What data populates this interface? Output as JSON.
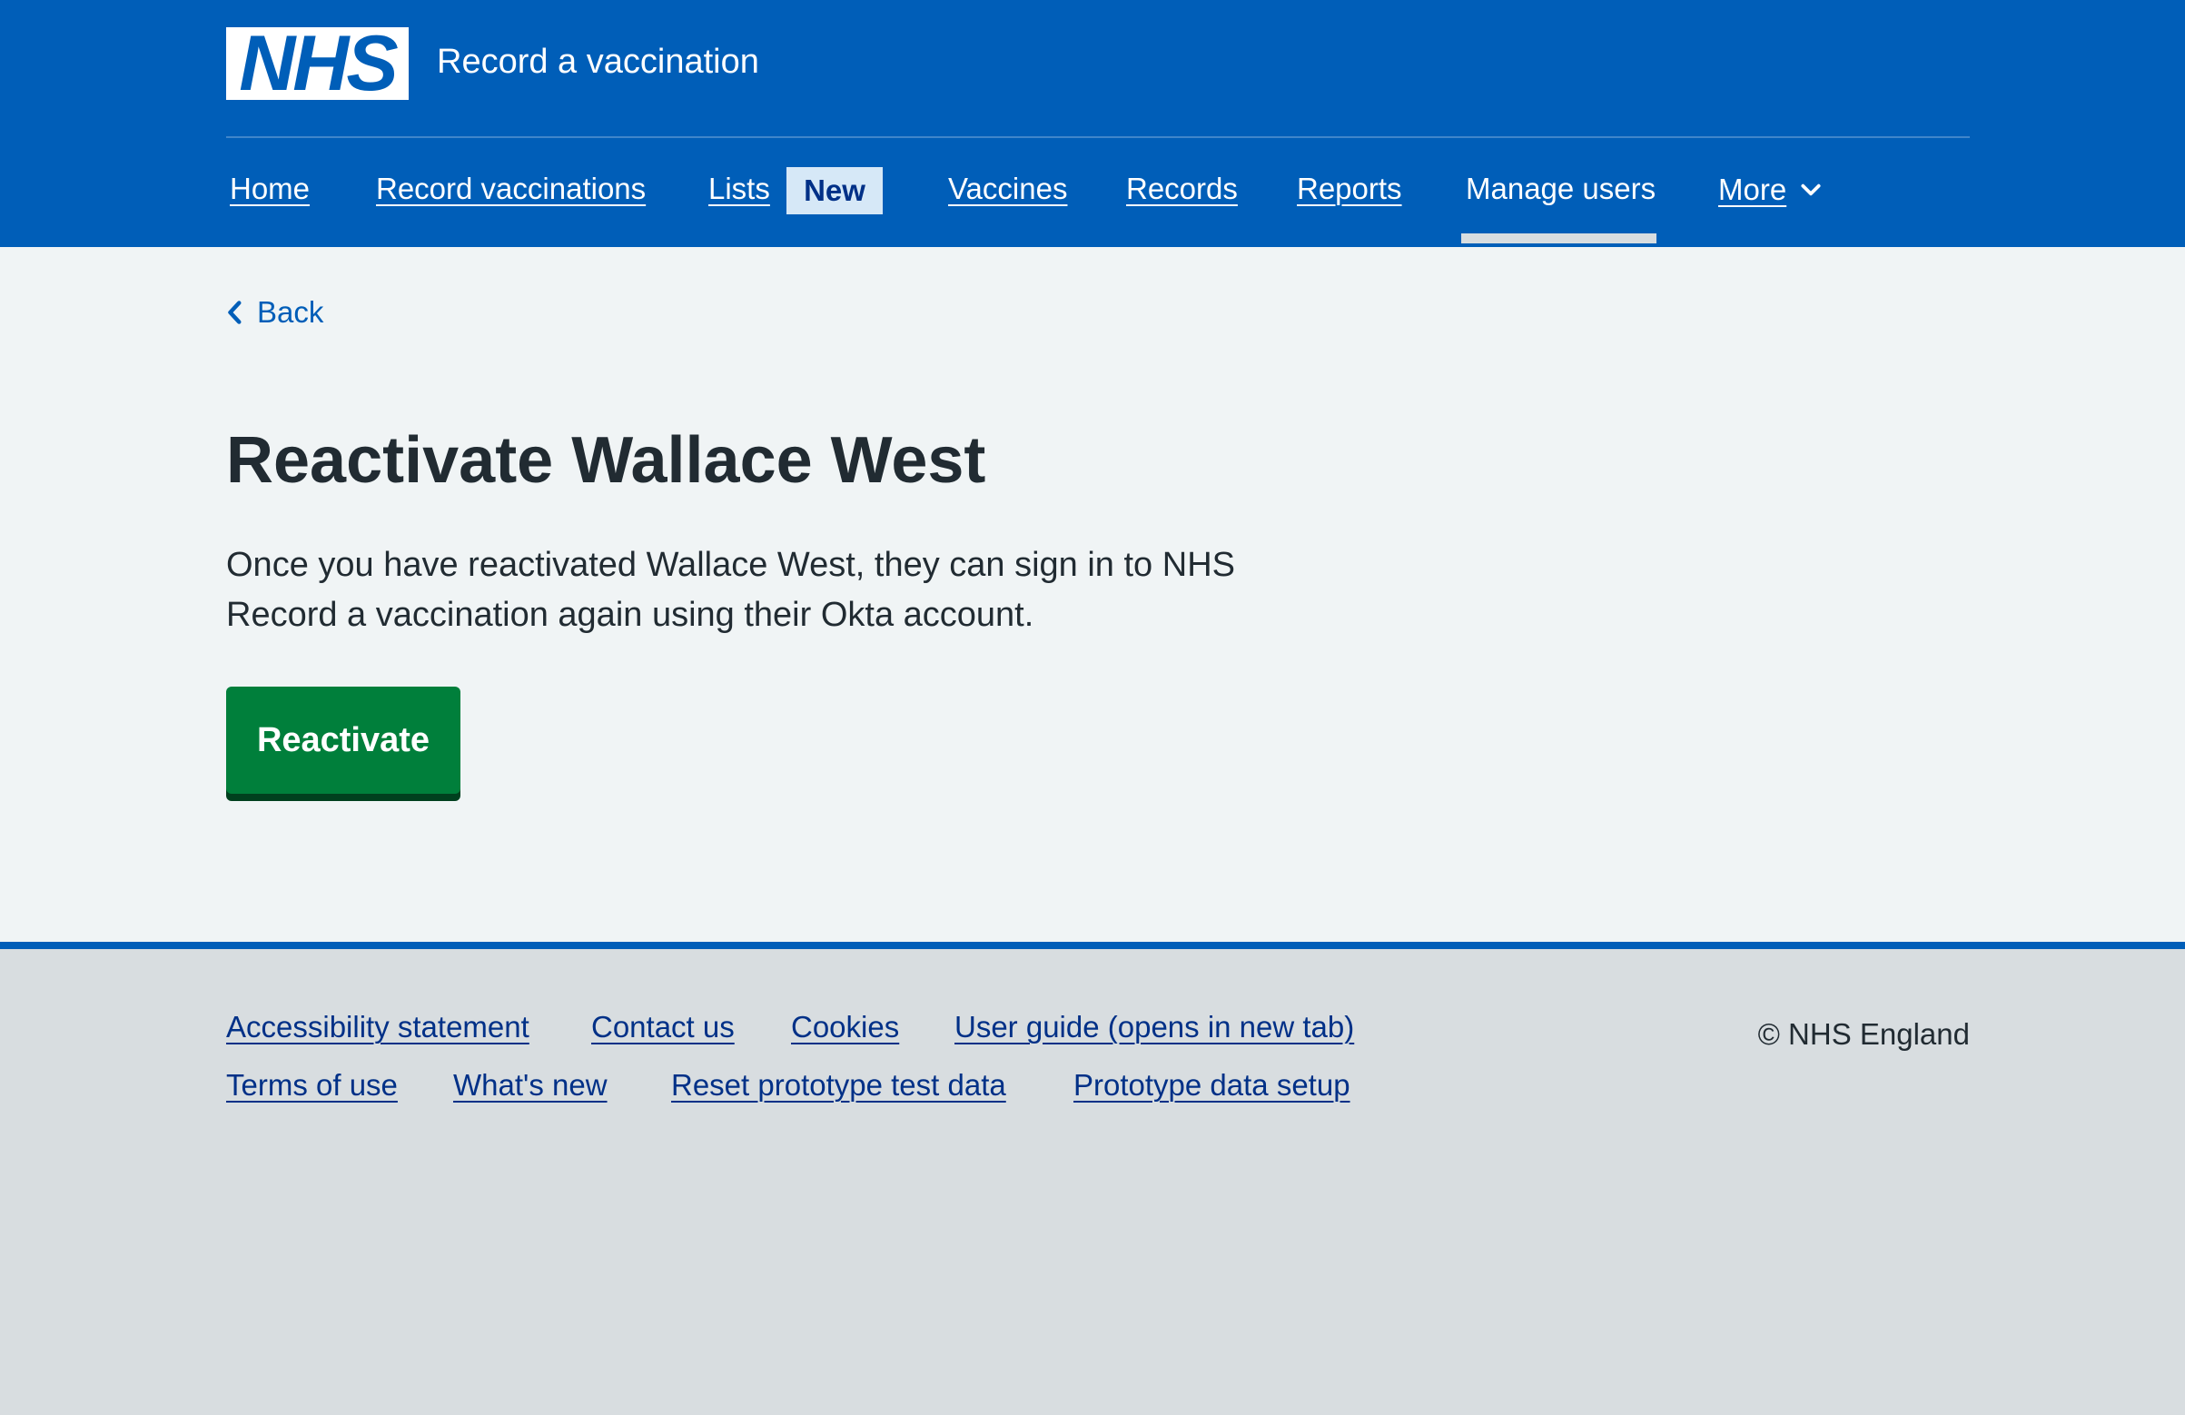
{
  "header": {
    "logo_text": "NHS",
    "service_name": "Record a vaccination",
    "brand_color": "#005eb8"
  },
  "nav": {
    "items": [
      {
        "label": "Home"
      },
      {
        "label": "Record vaccinations"
      },
      {
        "label": "Lists",
        "tag": "New"
      },
      {
        "label": "Vaccines"
      },
      {
        "label": "Records"
      },
      {
        "label": "Reports"
      },
      {
        "label": "Manage users",
        "current": true
      },
      {
        "label": "More",
        "icon": "chevron-down-icon"
      }
    ]
  },
  "main": {
    "back_label": "Back",
    "title": "Reactivate Wallace West",
    "body": "Once you have reactivated Wallace West, they can sign in to NHS Record a vaccination again using their Okta account.",
    "button_label": "Reactivate",
    "button_color": "#007f3b"
  },
  "footer": {
    "links": [
      {
        "label": "Accessibility statement"
      },
      {
        "label": "Contact us"
      },
      {
        "label": "Cookies"
      },
      {
        "label": "User guide (opens in new tab)"
      },
      {
        "label": "Terms of use"
      },
      {
        "label": "What's new"
      },
      {
        "label": "Reset prototype test data"
      },
      {
        "label": "Prototype data setup"
      }
    ],
    "copyright": "© NHS England"
  }
}
